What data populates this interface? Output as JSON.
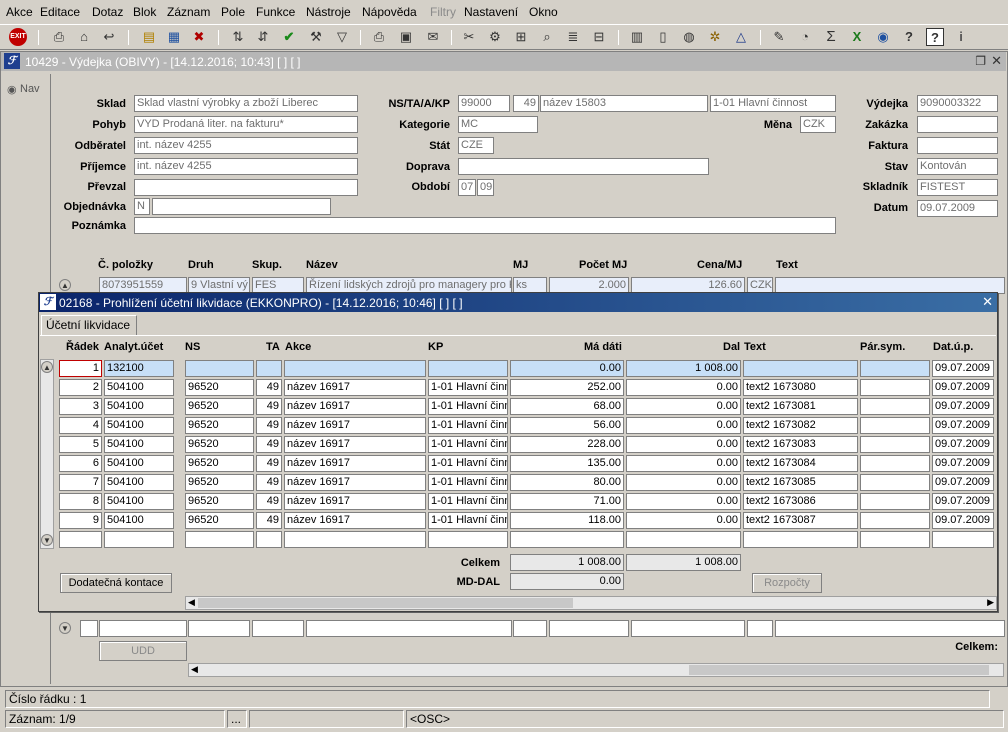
{
  "menu": [
    "Akce",
    "Editace",
    "Dotaz",
    "Blok",
    "Záznam",
    "Pole",
    "Funkce",
    "Nástroje",
    "Nápověda",
    "Filtry",
    "Nastavení",
    "Okno"
  ],
  "outer_window": {
    "title": "10429 - Výdejka (OBIVY) - [14.12.2016; 10:43] [ ] [ ]",
    "nav_label": "Nav"
  },
  "form": {
    "sklad_label": "Sklad",
    "sklad_value": "Sklad vlastní výrobky a zboží Liberec",
    "pohyb_label": "Pohyb",
    "pohyb_value": "VYD Prodaná liter. na fakturu*",
    "odberatel_label": "Odběratel",
    "odberatel_value": "int. název 4255",
    "prijemce_label": "Příjemce",
    "prijemce_value": "int. název 4255",
    "prevzal_label": "Převzal",
    "prevzal_value": "",
    "objednavka_label": "Objednávka",
    "objednavka_flag": "N",
    "objednavka_value": "",
    "poznamka_label": "Poznámka",
    "poznamka_value": "",
    "ns_label": "NS/TA/A/KP",
    "ns_value": "99000",
    "ta_value": "49",
    "a_value": "název 15803",
    "kp_value": "1-01 Hlavní činnost",
    "kategorie_label": "Kategorie",
    "kategorie_value": "MC",
    "stat_label": "Stát",
    "stat_value": "CZE",
    "doprava_label": "Doprava",
    "doprava_value": "",
    "obdobi_label": "Období",
    "obdobi_month": "07",
    "obdobi_year": "09",
    "mena_label": "Měna",
    "mena_value": "CZK",
    "vydejka_label": "Výdejka",
    "vydejka_value": "9090003322",
    "zakazka_label": "Zakázka",
    "zakazka_value": "",
    "faktura_label": "Faktura",
    "faktura_value": "",
    "stav_label": "Stav",
    "stav_value": "Kontován",
    "skladnik_label": "Skladník",
    "skladnik_value": "FISTEST",
    "datum_label": "Datum",
    "datum_value": "09.07.2009"
  },
  "items": {
    "headers": [
      "Č. položky",
      "Druh",
      "Skup.",
      "Název",
      "MJ",
      "Počet MJ",
      "Cena/MJ",
      "Text"
    ],
    "row": [
      "8073951559",
      "9 Vlastní vý",
      "FES",
      "Řízení lidských zdrojů pro managery pro K",
      "ks",
      "2.000",
      "126.60",
      "CZK"
    ],
    "udd_label": "UDD",
    "celkem_label": "Celkem:"
  },
  "dialog": {
    "title": "02168 - Prohlížení účetní likvidace (EKKONPRO) - [14.12.2016; 10:46] [ ] [ ]",
    "tab": "Účetní likvidace",
    "headers": [
      "Řádek",
      "Analyt.účet",
      "NS",
      "TA",
      "Akce",
      "KP",
      "Má dáti",
      "Dal",
      "Text",
      "Pár.sym.",
      "Dat.ú.p."
    ],
    "rows": [
      [
        "1",
        "132100",
        "",
        "",
        "",
        "",
        "0.00",
        "1 008.00",
        "",
        "",
        "09.07.2009"
      ],
      [
        "2",
        "504100",
        "96520",
        "49",
        "název 16917",
        "1-01 Hlavní činn",
        "252.00",
        "0.00",
        "text2 1673080",
        "",
        "09.07.2009"
      ],
      [
        "3",
        "504100",
        "96520",
        "49",
        "název 16917",
        "1-01 Hlavní činn",
        "68.00",
        "0.00",
        "text2 1673081",
        "",
        "09.07.2009"
      ],
      [
        "4",
        "504100",
        "96520",
        "49",
        "název 16917",
        "1-01 Hlavní činn",
        "56.00",
        "0.00",
        "text2 1673082",
        "",
        "09.07.2009"
      ],
      [
        "5",
        "504100",
        "96520",
        "49",
        "název 16917",
        "1-01 Hlavní činn",
        "228.00",
        "0.00",
        "text2 1673083",
        "",
        "09.07.2009"
      ],
      [
        "6",
        "504100",
        "96520",
        "49",
        "název 16917",
        "1-01 Hlavní činn",
        "135.00",
        "0.00",
        "text2 1673084",
        "",
        "09.07.2009"
      ],
      [
        "7",
        "504100",
        "96520",
        "49",
        "název 16917",
        "1-01 Hlavní činn",
        "80.00",
        "0.00",
        "text2 1673085",
        "",
        "09.07.2009"
      ],
      [
        "8",
        "504100",
        "96520",
        "49",
        "název 16917",
        "1-01 Hlavní činn",
        "71.00",
        "0.00",
        "text2 1673086",
        "",
        "09.07.2009"
      ],
      [
        "9",
        "504100",
        "96520",
        "49",
        "název 16917",
        "1-01 Hlavní činn",
        "118.00",
        "0.00",
        "text2 1673087",
        "",
        "09.07.2009"
      ]
    ],
    "celkem_label": "Celkem",
    "celkem_ma_dati": "1 008.00",
    "celkem_dal": "1 008.00",
    "mddal_label": "MD-DAL",
    "mddal_value": "0.00",
    "dodatecna_button": "Dodatečná kontace",
    "rozpocty_button": "Rozpočty"
  },
  "status": {
    "cislo_radku": "Číslo řádku : 1",
    "zaznam": "Záznam: 1/9",
    "ellipsis": "...",
    "osc": "<OSC>"
  },
  "icons": [
    "exit-icon",
    "ok-check-icon",
    "sum-icon",
    "help-icon",
    "info-icon"
  ]
}
